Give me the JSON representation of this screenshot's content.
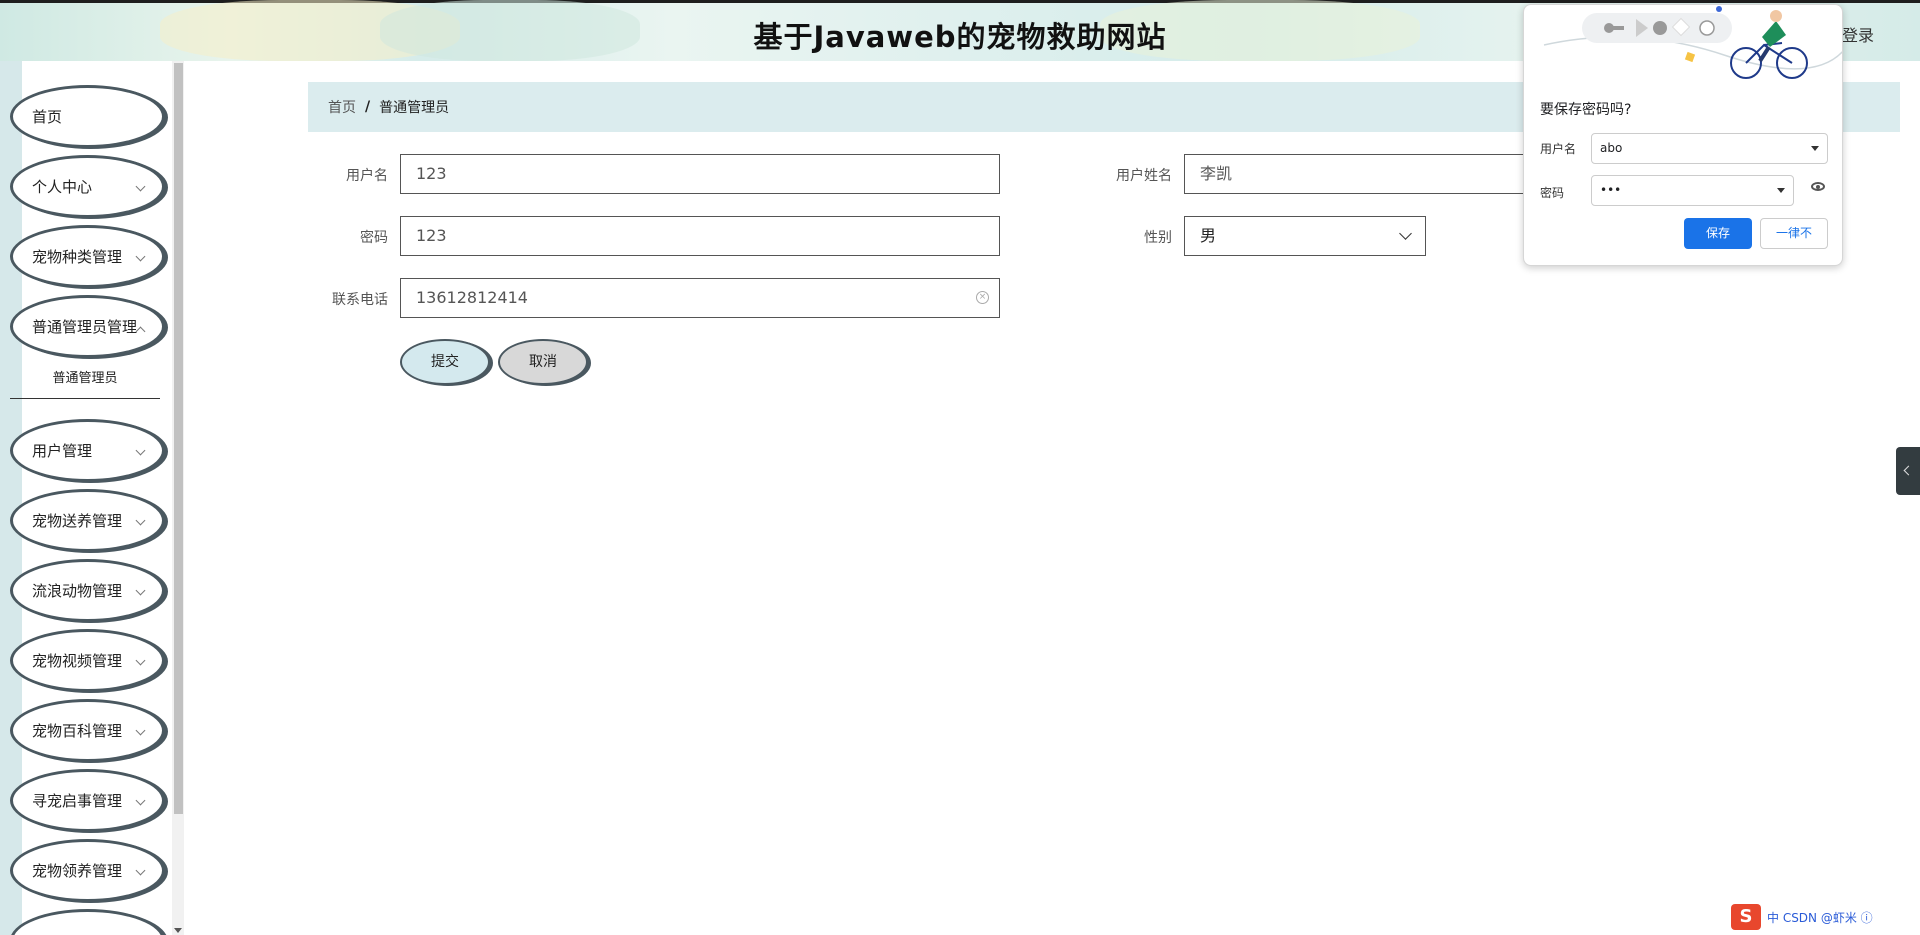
{
  "header": {
    "title": "基于Javaweb的宠物救助网站",
    "login_label": "登录"
  },
  "sidebar": {
    "items": [
      {
        "label": "首页"
      },
      {
        "label": "个人中心"
      },
      {
        "label": "宠物种类管理"
      },
      {
        "label": "普通管理员管理"
      },
      {
        "label": "用户管理"
      },
      {
        "label": "宠物送养管理"
      },
      {
        "label": "流浪动物管理"
      },
      {
        "label": "宠物视频管理"
      },
      {
        "label": "宠物百科管理"
      },
      {
        "label": "寻宠启事管理"
      },
      {
        "label": "宠物领养管理"
      }
    ],
    "submenu_label": "普通管理员"
  },
  "breadcrumb": {
    "home": "首页",
    "separator": "/",
    "current": "普通管理员"
  },
  "form": {
    "username_label": "用户名",
    "username_value": "123",
    "password_label": "密码",
    "password_value": "123",
    "phone_label": "联系电话",
    "phone_value": "13612812414",
    "realname_label": "用户姓名",
    "realname_value": "李凯",
    "gender_label": "性别",
    "gender_value": "男",
    "submit_label": "提交",
    "cancel_label": "取消"
  },
  "password_popup": {
    "question": "要保存密码吗?",
    "username_label": "用户名",
    "username_value": "abo",
    "password_label": "密码",
    "password_value": "•••",
    "save_label": "保存",
    "never_label": "一律不"
  },
  "tray": {
    "logo": "S",
    "text": "中 CSDN @虾米 ⓘ"
  },
  "colors": {
    "breadcrumb_bg": "#dbecee",
    "save_button": "#1a73e8",
    "menu_border": "#4a5860"
  }
}
